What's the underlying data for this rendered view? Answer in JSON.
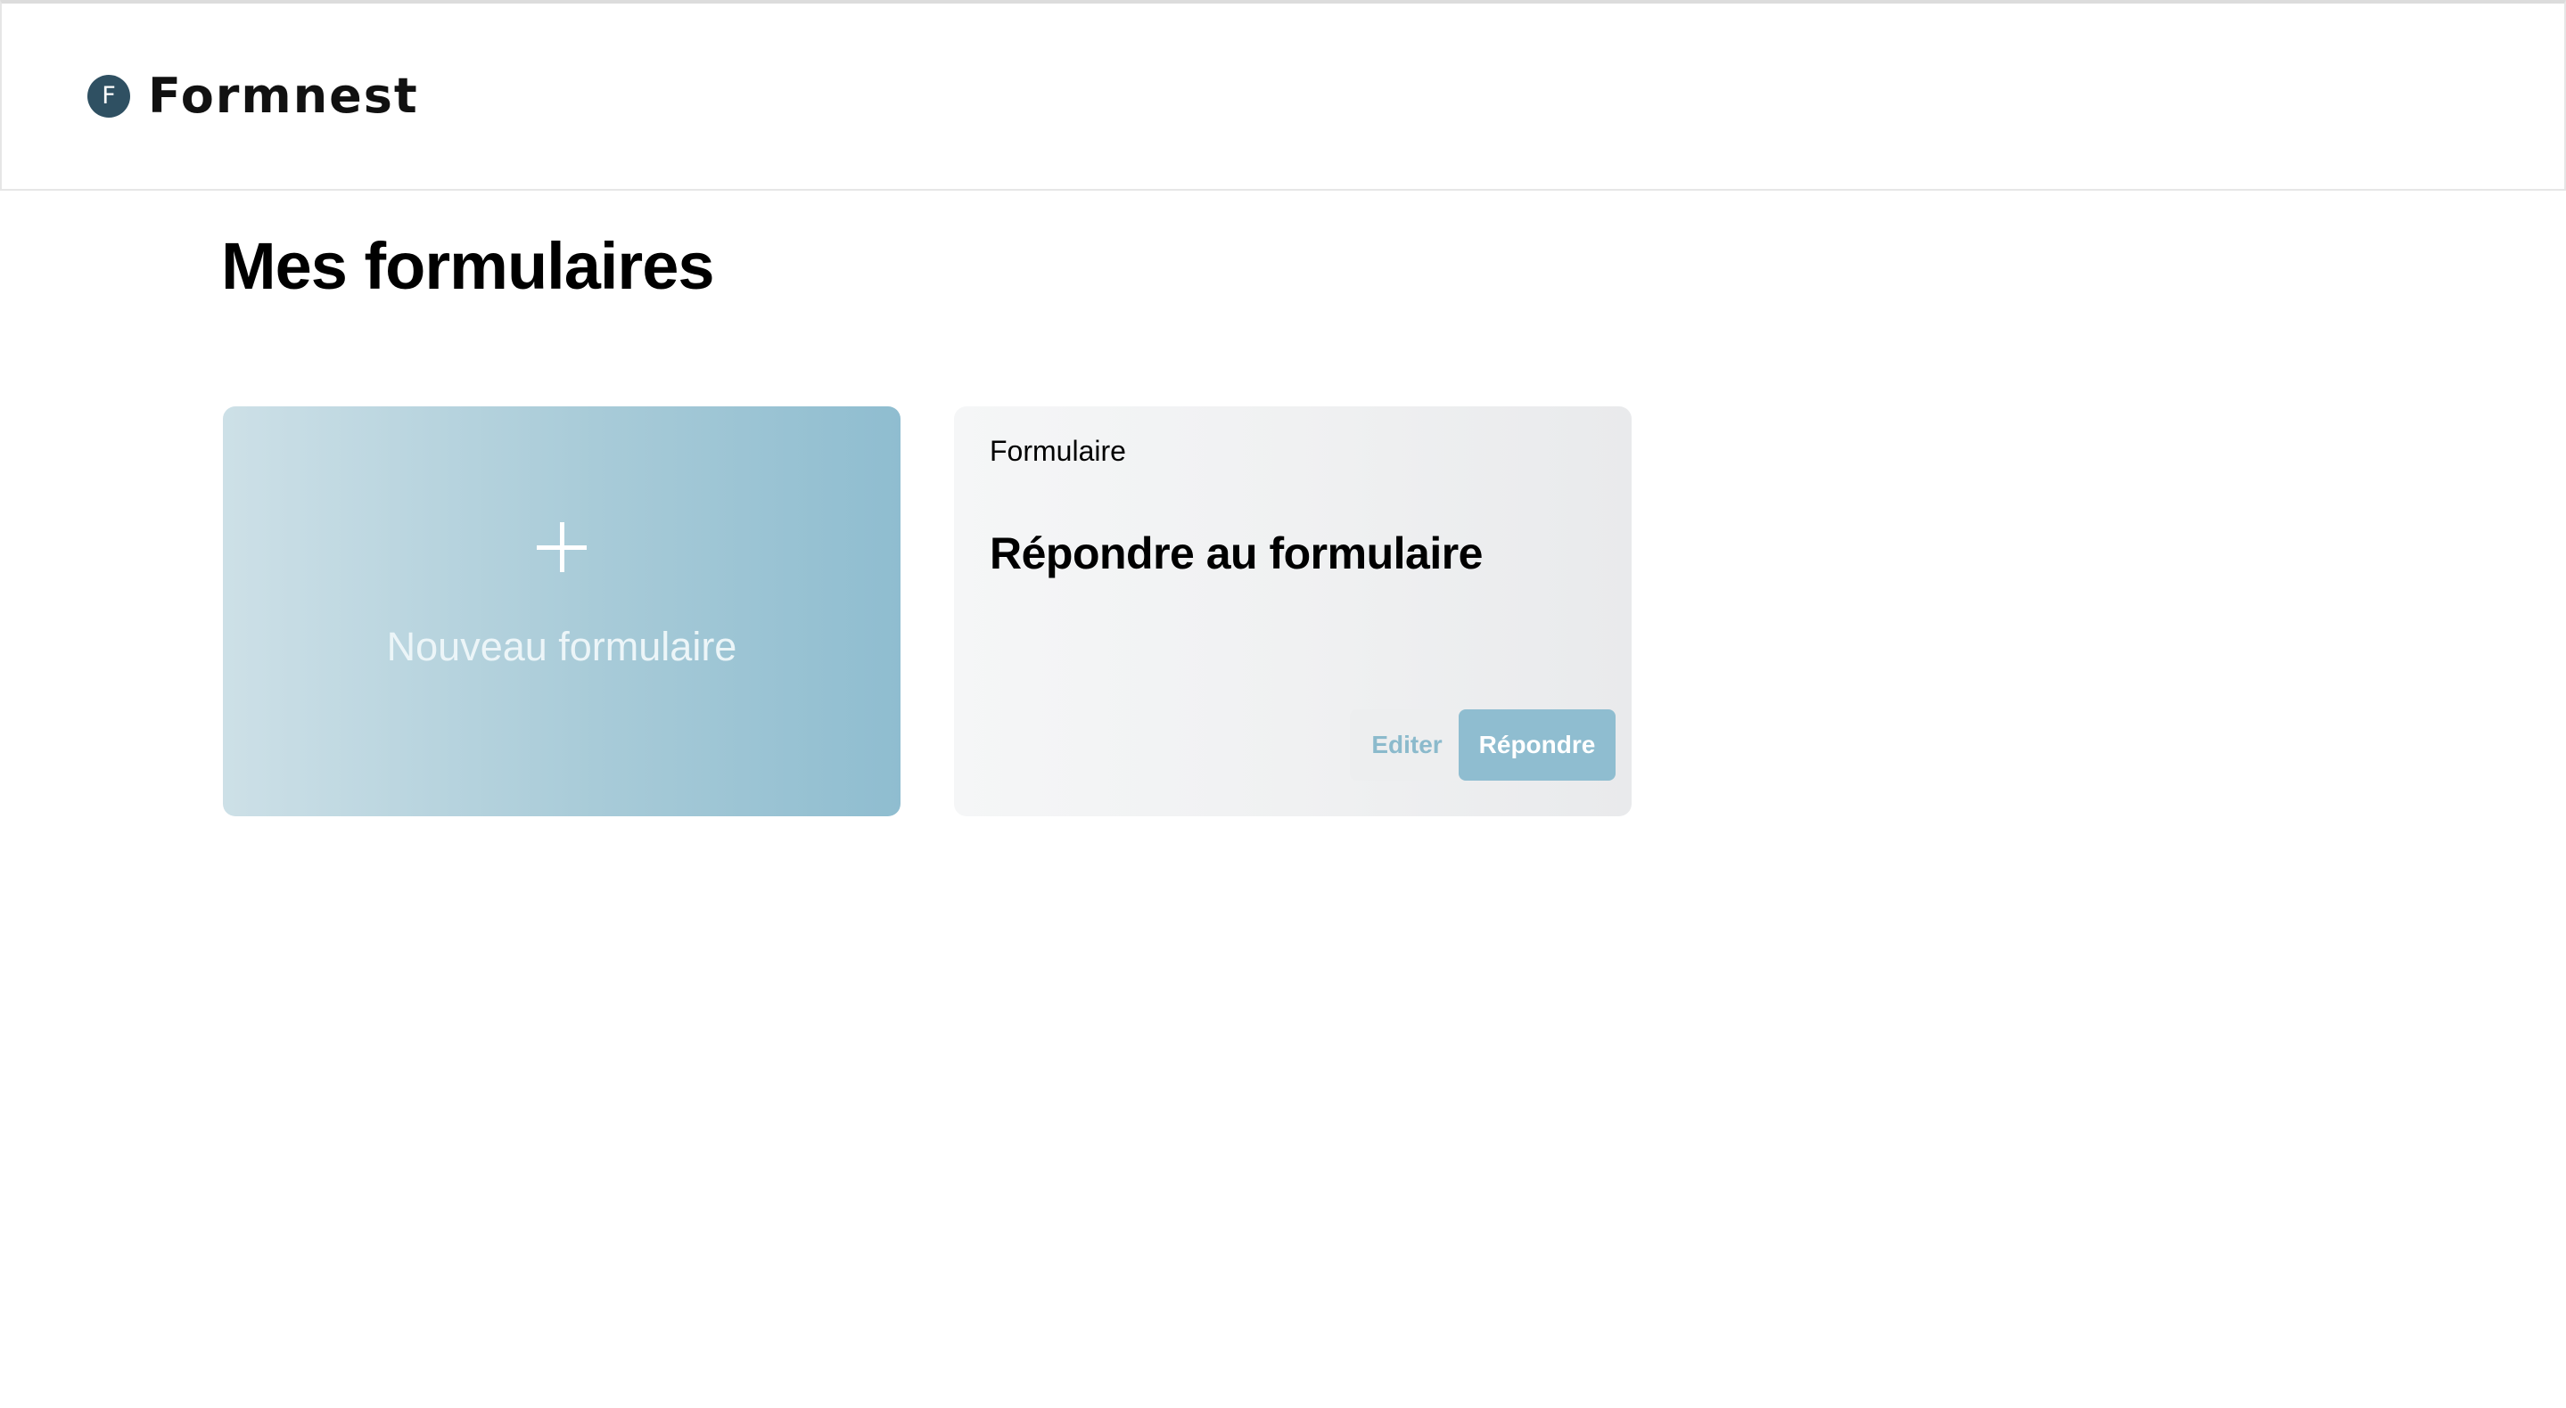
{
  "header": {
    "logo_letter": "F",
    "brand_name": "Formnest"
  },
  "page": {
    "title": "Mes formulaires"
  },
  "new_form_card": {
    "icon": "plus-icon",
    "label": "Nouveau formulaire"
  },
  "forms": [
    {
      "type_label": "Formulaire",
      "title": "Répondre au formulaire",
      "edit_label": "Editer",
      "answer_label": "Répondre"
    }
  ],
  "colors": {
    "brand_dark": "#2f5062",
    "accent": "#8fbdd0",
    "accent_light": "#cde0e7",
    "card_gray": "#f0f1f2"
  }
}
